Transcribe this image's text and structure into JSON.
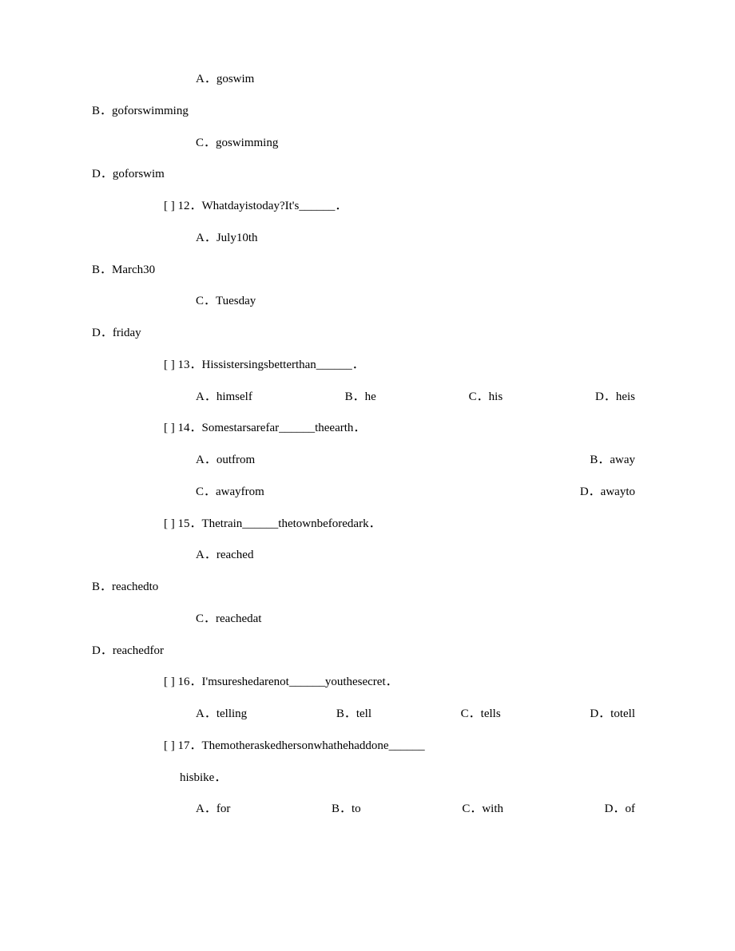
{
  "q11": {
    "a": "A．goswim",
    "b": "B．goforswimming",
    "c": "C．goswimming",
    "d": "D．goforswim"
  },
  "q12": {
    "stem": "[ ] 12．Whatdayistoday?It's______．",
    "a": "A．July10th",
    "b": "B．March30",
    "c": "C．Tuesday",
    "d": "D．friday"
  },
  "q13": {
    "stem": "[ ] 13．Hissistersingsbetterthan______．",
    "a": "A．himself",
    "b": "B．he",
    "c": "C．his",
    "d": "D．heis"
  },
  "q14": {
    "stem": "[ ] 14．Somestarsarefar______theearth．",
    "a": "A．outfrom",
    "b": "B．away",
    "c": "C．awayfrom",
    "d": "D．awayto"
  },
  "q15": {
    "stem": "[ ] 15．Thetrain______thetownbeforedark．",
    "a": "A．reached",
    "b": "B．reachedto",
    "c": "C．reachedat",
    "d": "D．reachedfor"
  },
  "q16": {
    "stem": "[ ] 16．I'msureshedarenot______youthesecret．",
    "a": "A．telling",
    "b": "B．tell",
    "c": "C．tells",
    "d": "D．totell"
  },
  "q17": {
    "stem": "[ ] 17．Themotheraskedhersonwhathehaddone______",
    "cont": "hisbike．",
    "a": "A．for",
    "b": "B．to",
    "c": "C．with",
    "d": "D．of"
  }
}
